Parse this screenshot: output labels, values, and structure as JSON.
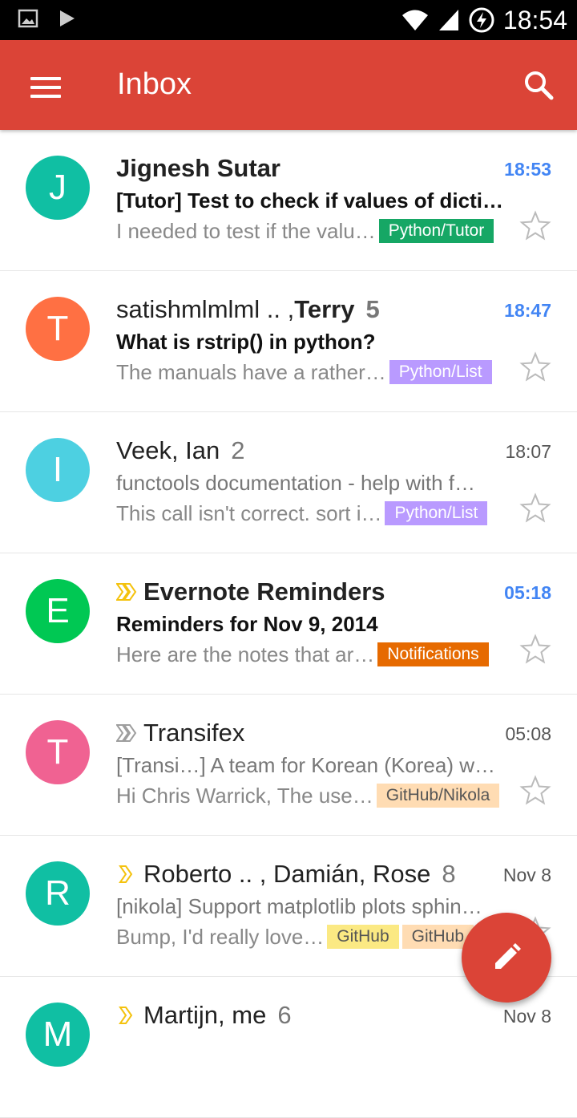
{
  "status_bar": {
    "time": "18:54",
    "icons": [
      "image-icon",
      "play-icon",
      "wifi-icon",
      "signal-icon",
      "sync-icon"
    ]
  },
  "app_bar": {
    "title": "Inbox",
    "menu_icon": "menu-icon",
    "search_icon": "search-icon",
    "color": "#db4437"
  },
  "emails": [
    {
      "avatar_letter": "J",
      "avatar_color": "#10bfa3",
      "sender": "Jignesh Sutar",
      "sender_bold": true,
      "count": "",
      "time": "18:53",
      "unread": true,
      "importance": "",
      "subject": "[Tutor] Test to check if values of dicti…",
      "snippet": "I needed to test if the valu…",
      "labels": [
        {
          "text": "Python/Tutor",
          "bg": "#16a765",
          "fg": "#ffffff"
        }
      ]
    },
    {
      "avatar_letter": "T",
      "avatar_color": "#ff7043",
      "sender": "satishmlmlml .. , ",
      "sender_bold_part": "Terry",
      "sender_bold": false,
      "count": "5",
      "time": "18:47",
      "unread": true,
      "importance": "",
      "subject": "What is rstrip() in python?",
      "snippet": "The manuals have a rather…",
      "labels": [
        {
          "text": "Python/List",
          "bg": "#b99aff",
          "fg": "#ffffff"
        }
      ]
    },
    {
      "avatar_letter": "I",
      "avatar_color": "#4dd0e1",
      "sender": "Veek, Ian",
      "sender_bold": false,
      "count": "2",
      "time": "18:07",
      "unread": false,
      "importance": "",
      "subject": "functools documentation - help with f…",
      "snippet": "This call isn't correct. sort i…",
      "labels": [
        {
          "text": "Python/List",
          "bg": "#b99aff",
          "fg": "#ffffff"
        }
      ]
    },
    {
      "avatar_letter": "E",
      "avatar_color": "#00c853",
      "sender": "Evernote Reminders",
      "sender_bold": true,
      "count": "",
      "time": "05:18",
      "unread": true,
      "importance": "double-yellow",
      "subject": "Reminders for Nov 9, 2014",
      "snippet": "Here are the notes that ar…",
      "labels": [
        {
          "text": "Notifications",
          "bg": "#e66a00",
          "fg": "#ffffff"
        }
      ]
    },
    {
      "avatar_letter": "T",
      "avatar_color": "#f06292",
      "sender": "Transifex",
      "sender_bold": false,
      "count": "",
      "time": "05:08",
      "unread": false,
      "importance": "double-gray",
      "subject": "[Transi…] A team for Korean (Korea) w…",
      "snippet": "Hi Chris Warrick, The use…",
      "labels": [
        {
          "text": "GitHub/Nikola",
          "bg": "#ffdcb3",
          "fg": "#555555"
        }
      ]
    },
    {
      "avatar_letter": "R",
      "avatar_color": "#10bfa3",
      "sender": "Roberto .. , Damián, Rose",
      "sender_bold": false,
      "count": "8",
      "time": "Nov 8",
      "unread": false,
      "importance": "single-yellow",
      "subject": "[nikola] Support matplotlib plots sphin…",
      "snippet": "Bump, I'd really love…",
      "labels": [
        {
          "text": "GitHub",
          "bg": "#fbe983",
          "fg": "#555555"
        },
        {
          "text": "GitHub",
          "bg": "#ffdcb3",
          "fg": "#555555"
        }
      ]
    },
    {
      "avatar_letter": "M",
      "avatar_color": "#10bfa3",
      "sender": "Martijn, me",
      "sender_bold": false,
      "count": "6",
      "time": "Nov 8",
      "unread": false,
      "importance": "single-yellow",
      "subject": "",
      "snippet": "",
      "labels": []
    }
  ],
  "fab": {
    "icon": "pencil-icon",
    "color": "#db4437"
  }
}
